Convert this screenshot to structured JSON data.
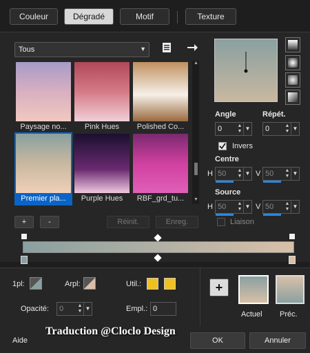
{
  "tabs": [
    {
      "label": "Couleur"
    },
    {
      "label": "Dégradé"
    },
    {
      "label": "Motif"
    },
    {
      "label": "Texture"
    }
  ],
  "library": {
    "selected": "Tous"
  },
  "thumbnails": [
    {
      "label": "Paysage no...",
      "colors": [
        "#a69bc8",
        "#d8b0c0",
        "#f0c8c0"
      ]
    },
    {
      "label": "Pink Hues",
      "colors": [
        "#b04858",
        "#d67a88",
        "#f0d0d8"
      ]
    },
    {
      "label": "Polished Co...",
      "colors": [
        "#c09060",
        "#f6f0e8",
        "#9a6a40"
      ]
    },
    {
      "label": "Premier pla...",
      "colors": [
        "#8aa0a0",
        "#c8b8a0",
        "#f0d0b8"
      ]
    },
    {
      "label": "Purple Hues",
      "colors": [
        "#1a1030",
        "#6a2a70",
        "#f0c8e0"
      ]
    },
    {
      "label": "RBF_grd_tu...",
      "colors": [
        "#7a2a70",
        "#d040a0",
        "#e060b8"
      ]
    }
  ],
  "angle": {
    "label": "Angle",
    "value": "0"
  },
  "repeat": {
    "label": "Répét.",
    "value": "0"
  },
  "invert": {
    "label": "Invers",
    "checked": true
  },
  "center": {
    "label": "Centre",
    "h_label": "H",
    "h_value": "50",
    "v_label": "V",
    "v_value": "50"
  },
  "source": {
    "label": "Source",
    "h_label": "H",
    "h_value": "50",
    "v_label": "V",
    "v_value": "50"
  },
  "buttons": {
    "add": "+",
    "remove": "-",
    "rename": "Réinit.",
    "save": "Enreg.",
    "link": "Liaison"
  },
  "bottom": {
    "p1_label": "1pl:",
    "arpl_label": "Arpl:",
    "util_label": "Util.:",
    "opacity_label": "Opacité:",
    "opacity_value": "0",
    "empl_label": "Empl.:",
    "empl_value": "0",
    "actual_label": "Actuel",
    "prev_label": "Préc.",
    "plus_button": "+"
  },
  "footer": {
    "help": "Aide",
    "watermark": "Traduction @Cloclo Design",
    "ok": "OK",
    "cancel": "Annuler"
  },
  "colors": {
    "swatch_yellow": "#f0c020",
    "gradient_start": "#8aa0a0",
    "gradient_end": "#d8c0a8",
    "accent": "#0a64c8"
  }
}
